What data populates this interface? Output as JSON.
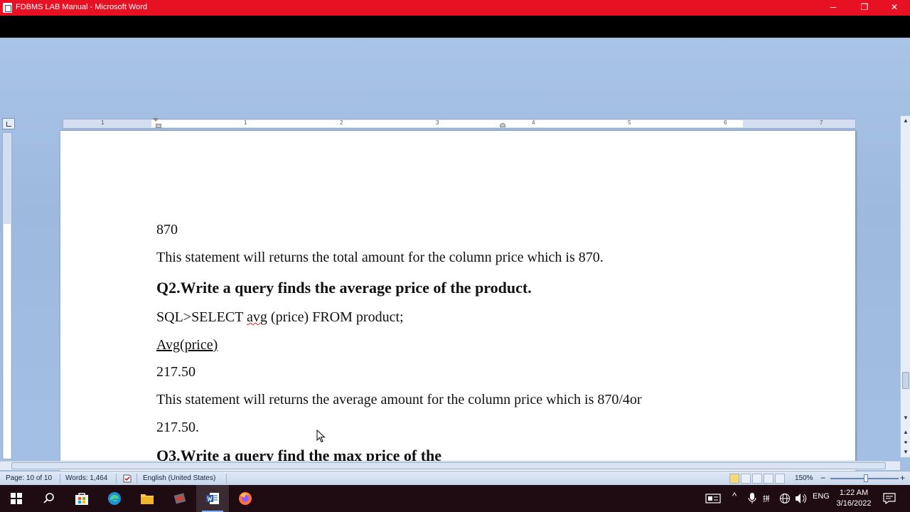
{
  "window": {
    "title": "FDBMS LAB Manual - Microsoft Word",
    "minimize_glyph": "─",
    "restore_glyph": "❐",
    "close_glyph": "✕"
  },
  "ruler": {
    "numbers": [
      "1",
      "1",
      "2",
      "3",
      "4",
      "5",
      "6",
      "7"
    ]
  },
  "document": {
    "lines": [
      {
        "id": "l1",
        "text": "870"
      },
      {
        "id": "l2",
        "text": "This statement will returns the total amount for the column price which is 870."
      },
      {
        "id": "l3",
        "text": "Q2.Write a query finds the average price of the product."
      },
      {
        "id": "l4a",
        "text": "SQL>SELECT "
      },
      {
        "id": "l4b",
        "text": "avg"
      },
      {
        "id": "l4c",
        "text": " (price) FROM product;"
      },
      {
        "id": "l5",
        "text": "Avg(price)"
      },
      {
        "id": "l6",
        "text": "217.50"
      },
      {
        "id": "l7",
        "text": "This statement will returns the average amount for the column price which is 870/4or"
      },
      {
        "id": "l8",
        "text": "217.50."
      },
      {
        "id": "l9",
        "text": "Q3.Write a query find the max price of the"
      }
    ]
  },
  "status": {
    "page": "Page: 10 of 10",
    "words": "Words: 1,464",
    "language": "English (United States)",
    "zoom": "150%",
    "zoom_minus": "−",
    "zoom_plus": "+"
  },
  "taskbar": {
    "tray_lang": "ENG",
    "time": "1:22 AM",
    "date": "3/16/2022"
  },
  "colors": {
    "titlebar": "#e81123",
    "taskbar": "#1f0c12",
    "workspace": "#a9c4e6"
  }
}
